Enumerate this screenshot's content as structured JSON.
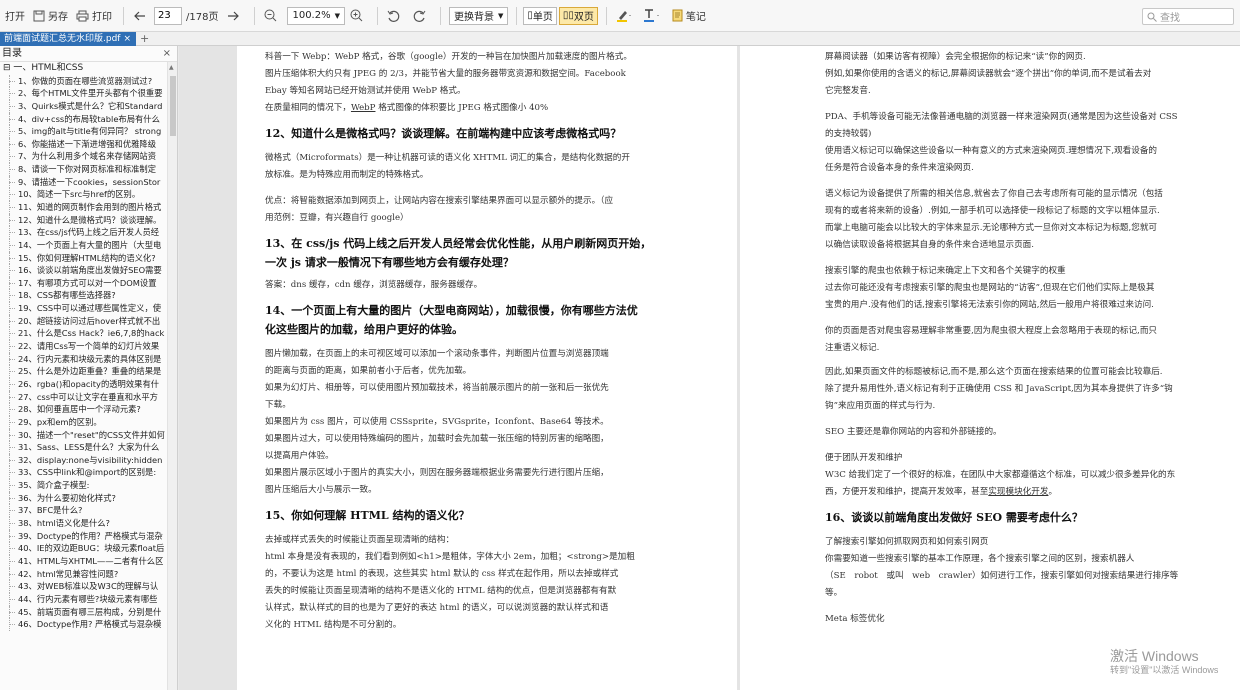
{
  "toolbar": {
    "open": "打开",
    "save_as": "另存",
    "print": "打印",
    "page_current": "23",
    "page_total": "/178页",
    "zoom": "100.2%",
    "background": "更换背景",
    "single_page": "单页",
    "double_page": "双页",
    "notes": "笔记",
    "search_placeholder": "查找"
  },
  "tabs": {
    "doc_title": "前端面试题汇总无水印版.pdf",
    "close": "×",
    "add": "+"
  },
  "sidebar": {
    "title": "目录",
    "close": "×",
    "root": "⊟ 一、HTML和CSS",
    "items": [
      "1、你做的页面在哪些流览器测试过?",
      "2、每个HTML文件里开头都有个很重要",
      "3、Quirks模式是什么？它和Standard",
      "4、div+css的布局较table布局有什么",
      "5、img的alt与title有何异同？ strong",
      "6、你能描述一下渐进增强和优雅降级",
      "7、为什么利用多个域名来存储网站资",
      "8、请谈一下你对网页标准和标准制定",
      "9、请描述一下cookies，sessionStor",
      "10、简述一下src与href的区别。",
      "11、知道的网页制作会用到的图片格式",
      "12、知道什么是微格式吗？谈谈理解。",
      "13、在css/js代码上线之后开发人员经",
      "14、一个页面上有大量的图片（大型电",
      "15、你如何理解HTML结构的语义化?",
      "16、谈谈以前端角度出发做好SEO需要",
      "17、有哪项方式可以对一个DOM设置",
      "18、CSS都有哪些选择器?",
      "19、CSS中可以通过哪些属性定义，使",
      "20、超链接访问过后hover样式就不出",
      "21、什么是Css Hack？ie6,7,8的hack",
      "22、请用Css写一个简单的幻灯片效果",
      "24、行内元素和块级元素的具体区别是",
      "25、什么是外边距重叠？重叠的结果是",
      "26、rgba()和opacity的透明效果有什",
      "27、css中可以让文字在垂直和水平方",
      "28、如何垂直居中一个浮动元素?",
      "29、px和em的区别。",
      "30、描述一个\"reset\"的CSS文件并如何",
      "31、Sass、LESS是什么？大家为什么",
      "32、display:none与visibility:hidden",
      "33、CSS中link和@import的区别是:",
      "35、简介盒子模型:",
      "36、为什么要初始化样式?",
      "37、BFC是什么?",
      "38、html语义化是什么?",
      "39、Doctype的作用？严格模式与混杂",
      "40、IE的双边距BUG：块级元素float后",
      "41、HTML与XHTML——二者有什么区",
      "42、html常见兼容性问题?",
      "43、对WEB标准以及W3C的理解与认",
      "44、行内元素有哪些?块级元素有哪些",
      "45、前端页面有哪三层构成，分别是什",
      "46、Doctype作用? 严格模式与混杂模"
    ]
  },
  "left_page": {
    "p1": "科普一下 Webp：WebP 格式，谷歌（google）开发的一种旨在加快图片加载速度的图片格式。",
    "p2": "图片压缩体积大约只有 JPEG 的 2/3，并能节省大量的服务器带宽资源和数据空间。Facebook",
    "p3": "Ebay 等知名网站已经开始测试并使用 WebP 格式。",
    "p4a": "在质量相同的情况下，",
    "p4b": "WebP",
    "p4c": " 格式图像的体积要比 JPEG 格式图像小 40%",
    "h12": "12、知道什么是微格式吗？谈谈理解。在前端构建中应该考虑微格式吗？",
    "p5": "微格式（Microformats）是一种让机器可读的语义化 XHTML 词汇的集合，是结构化数据的开",
    "p6": "放标准。是为特殊应用而制定的特殊格式。",
    "p7": "优点：将智能数据添加到网页上，让网站内容在搜索引擎结果界面可以显示额外的提示。（应",
    "p8": "用范例：豆瓣，有兴趣自行 google）",
    "h13a": "13、在 css/js 代码上线之后开发人员经常会优化性能，从用户刷新网页开始，",
    "h13b": "一次 js 请求一般情况下有哪些地方会有缓存处理？",
    "p9": "答案：dns 缓存，cdn 缓存，浏览器缓存，服务器缓存。",
    "h14a": "14、一个页面上有大量的图片（大型电商网站），加载很慢，你有哪些方法优",
    "h14b": "化这些图片的加载，给用户更好的体验。",
    "p10": "图片懒加载，在页面上的未可视区域可以添加一个滚动条事件，判断图片位置与浏览器顶端",
    "p11": "的距离与页面的距离，如果前者小于后者，优先加载。",
    "p12": "如果为幻灯片、相册等，可以使用图片预加载技术，将当前展示图片的前一张和后一张优先",
    "p13": "下载。",
    "p14": "如果图片为 css 图片，可以使用 CSSsprite，SVGsprite，Iconfont、Base64 等技术。",
    "p15": "如果图片过大，可以使用特殊编码的图片，加载时会先加载一张压缩的特别厉害的缩略图，",
    "p16": "以提高用户体验。",
    "p17": "如果图片展示区域小于图片的真实大小，则因在服务器端根据业务需要先行进行图片压缩，",
    "p18": "图片压缩后大小与展示一致。",
    "h15": "15、你如何理解 HTML 结构的语义化？",
    "p19": "去掉或样式丢失的时候能让页面呈现清晰的结构：",
    "p20": "html 本身是没有表现的，我们看到例如<h1>是粗体，字体大小 2em，加粗；<strong>是加粗",
    "p21": "的，不要认为这是 html 的表现，这些其实 html 默认的 css 样式在起作用，所以去掉或样式",
    "p22": "丢失的时候能让页面呈现清晰的结构不是语义化的 HTML 结构的优点，但是浏览器都有有默",
    "p23": "认样式，默认样式的目的也是为了更好的表达 html 的语义，可以说浏览器的默认样式和语",
    "p24": "义化的 HTML 结构是不可分割的。"
  },
  "right_page": {
    "r1": "屏幕阅读器（如果访客有视障）会完全根据你的标记来“读”你的网页.",
    "r2": "例如,如果你使用的含语义的标记,屏幕阅读器就会“逐个拼出”你的单词,而不是试着去对",
    "r3": "它完整发音.",
    "r4": "PDA、手机等设备可能无法像普通电脑的浏览器一样来渲染网页(通常是因为这些设备对 CSS",
    "r5": "的支持较弱)",
    "r6": "使用语义标记可以确保这些设备以一种有意义的方式来渲染网页.理想情况下,观看设备的",
    "r7": "任务是符合设备本身的条件来渲染网页.",
    "r8": "语义标记为设备提供了所需的相关信息,就省去了你自己去考虑所有可能的显示情况（包括",
    "r9": "现有的或者将来新的设备）.例如,一部手机可以选择使一段标记了标题的文字以粗体显示.",
    "r10": "而掌上电脑可能会以比较大的字体来显示.无论哪种方式一旦你对文本标记为标题,您就可",
    "r11": "以确信读取设备将根据其自身的条件来合适地显示页面.",
    "r12": "搜索引擎的爬虫也依赖于标记来确定上下文和各个关键字的权重",
    "r13": "过去你可能还没有考虑搜索引擎的爬虫也是网站的“访客”,但现在它们他们实际上是极其",
    "r14": "宝贵的用户.没有他们的话,搜索引擎将无法索引你的网站,然后一般用户将很难过来访问.",
    "r15": "你的页面是否对爬虫容易理解非常重要,因为爬虫很大程度上会忽略用于表现的标记,而只",
    "r16": "注重语义标记.",
    "r17": "因此,如果页面文件的标题被标记,而不是,那么这个页面在搜索结果的位置可能会比较靠后.",
    "r18": "除了提升易用性外,语义标记有利于正确使用 CSS 和 JavaScript,因为其本身提供了许多“钩",
    "r19": "钩”来应用页面的样式与行为.",
    "r20": "SEO 主要还是靠你网站的内容和外部链接的。",
    "r21": "便于团队开发和维护",
    "r22a": "W3C 给我们定了一个很好的标准，在团队中大家都遵循这个标准，可以减少很多差异化的东",
    "r22b": "西，方便开发和维护，提高开发效率，甚至",
    "r22c": "实现模块化开发",
    "r22d": "。",
    "h16": "16、谈谈以前端角度出发做好 SEO 需要考虑什么？",
    "r23": "了解搜索引擎如何抓取网页和如何索引网页",
    "r24": "你需要知道一些搜索引擎的基本工作原理，各个搜索引擎之间的区别，搜索机器人",
    "r25": "（SE　robot　或叫　web　crawler）如何进行工作，搜索引擎如何对搜索结果进行排序等",
    "r26": "等。",
    "r27": "Meta 标签优化"
  },
  "watermark": {
    "line1": "激活 Windows",
    "line2": "转到\"设置\"以激活 Windows"
  }
}
